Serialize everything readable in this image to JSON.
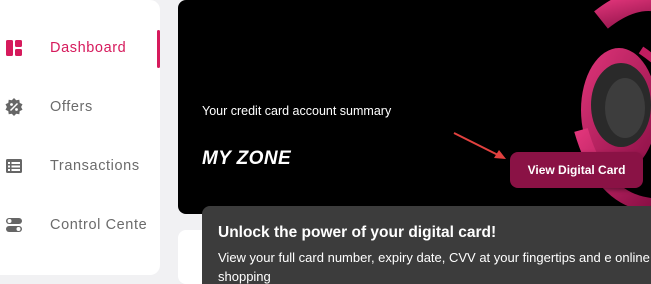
{
  "sidebar": {
    "items": [
      {
        "label": "Dashboard",
        "icon": "dashboard-icon",
        "active": true
      },
      {
        "label": "Offers",
        "icon": "offers-badge-icon",
        "active": false
      },
      {
        "label": "Transactions",
        "icon": "transactions-list-icon",
        "active": false
      },
      {
        "label": "Control Cente",
        "icon": "toggle-icon",
        "active": false
      }
    ],
    "accent_color": "#d61a5c"
  },
  "banner": {
    "subtitle": "Your credit card account summary",
    "title": "MY ZONE",
    "button_label": "View Digital Card",
    "button_color": "#8a1245"
  },
  "tooltip": {
    "title": "Unlock the power of your digital card!",
    "body": "View your full card number, expiry date, CVV at your fingertips and e online shopping"
  }
}
